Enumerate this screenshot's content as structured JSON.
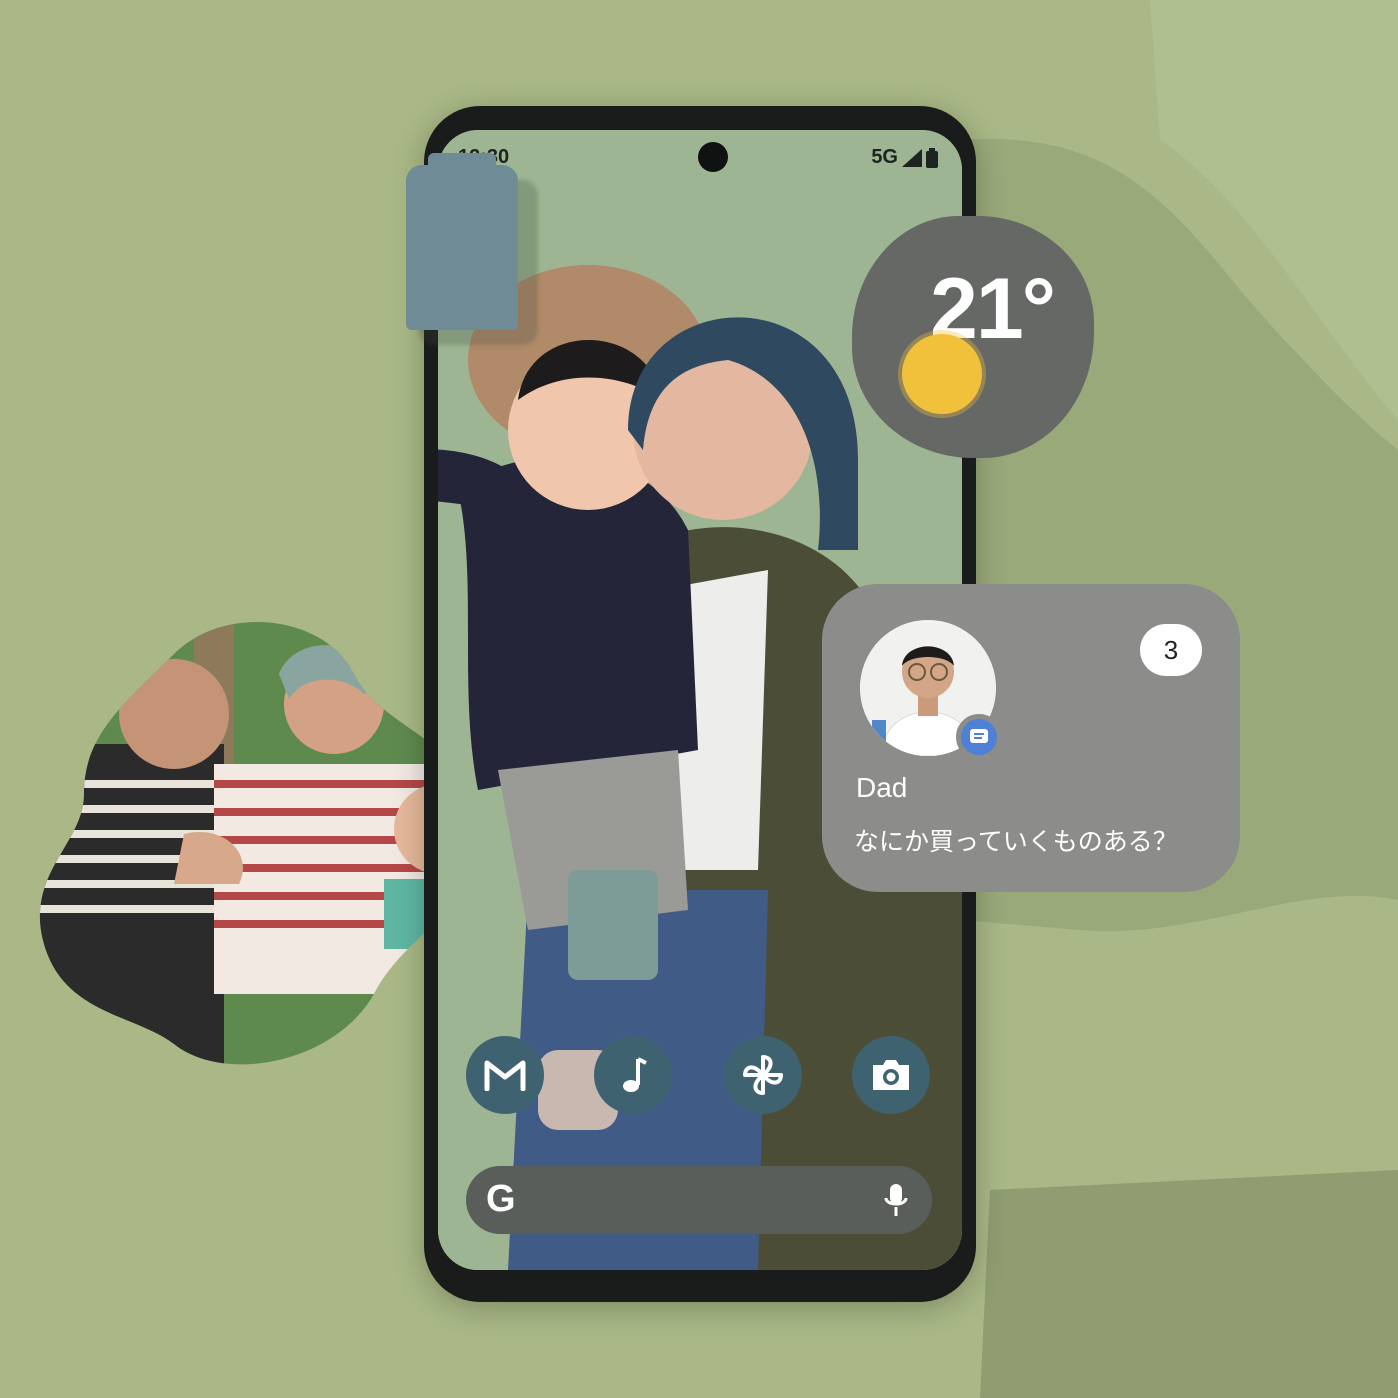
{
  "status_bar": {
    "time": "12:30",
    "network": "5G",
    "icons": [
      "signal-icon",
      "battery-icon"
    ]
  },
  "weather_widget": {
    "temperature": "21°",
    "icon": "sun-icon"
  },
  "conversation_widget": {
    "contact_name": "Dad",
    "message": "なにか買っていくものある？",
    "unread_count": "3",
    "app_badge_icon": "messages-icon"
  },
  "dock": {
    "apps": [
      {
        "name": "gmail",
        "icon": "gmail-icon"
      },
      {
        "name": "music",
        "icon": "music-note-icon"
      },
      {
        "name": "photos",
        "icon": "pinwheel-icon"
      },
      {
        "name": "camera",
        "icon": "camera-icon"
      }
    ]
  },
  "search_bar": {
    "logo": "G",
    "icon": "mic-icon"
  },
  "colors": {
    "background": "#a9b886",
    "widget_dark": "#666866",
    "widget_gray": "#8c8c8a",
    "dock_icon": "#3f6271",
    "accent_sun": "#f2c13b",
    "battery_widget": "#6f8b96"
  }
}
